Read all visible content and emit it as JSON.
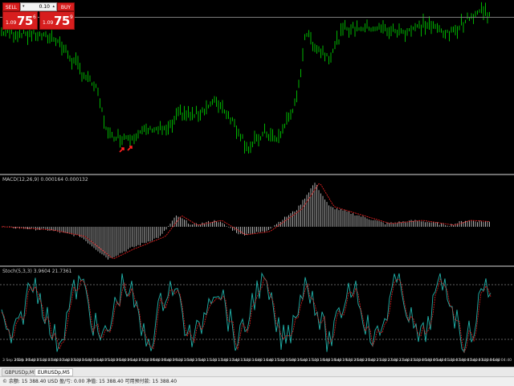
{
  "trade_panel": {
    "sell_label": "SELL",
    "buy_label": "BUY",
    "lot_value": "0.10",
    "sell_quote": {
      "small": "1.09",
      "big": "75",
      "sup": "6"
    },
    "buy_quote": {
      "small": "1.09",
      "big": "75",
      "sup": "9"
    }
  },
  "macd": {
    "label": "MACD(12,26,9) 0.000164 0.000132"
  },
  "stoch": {
    "label": "Stoch(5,3,3) 3.9604 21.7361"
  },
  "time_axis": {
    "labels": [
      "3 Sep 2019",
      "3 Sep 00:40",
      "3 Sep 01:20",
      "3 Sep 02:00",
      "3 Sep 02:40",
      "3 Sep 03:20",
      "3 Sep 04:00",
      "3 Sep 04:40",
      "3 Sep 05:20",
      "3 Sep 06:00",
      "3 Sep 06:40",
      "3 Sep 07:20",
      "3 Sep 08:00",
      "3 Sep 08:40",
      "3 Sep 09:20",
      "3 Sep 10:00",
      "3 Sep 10:40",
      "3 Sep 11:20",
      "3 Sep 12:00",
      "3 Sep 12:40",
      "3 Sep 13:20",
      "3 Sep 14:00",
      "3 Sep 14:40",
      "3 Sep 15:20",
      "3 Sep 16:00",
      "3 Sep 16:40",
      "3 Sep 17:20",
      "3 Sep 18:00",
      "3 Sep 18:40",
      "3 Sep 19:20",
      "3 Sep 20:00",
      "3 Sep 20:40",
      "3 Sep 21:20",
      "3 Sep 22:00",
      "3 Sep 22:40",
      "3 Sep 23:20",
      "4 Sep 00:00",
      "4 Sep 00:40",
      "4 Sep 01:20",
      "4 Sep 02:00",
      "4 Sep 02:40",
      "4 Sep 03:20",
      "4 Sep 04:00",
      "4 Sep 04:40"
    ]
  },
  "tabs": [
    {
      "label": "GBPUSDp,M5",
      "active": false
    },
    {
      "label": "EURUSDp,M5",
      "active": true
    }
  ],
  "status_bar": {
    "text": "© 余额: 15 388.40 USD  盈/亏: 0.00  净值: 15 388.40  可用预付款: 15 388.40"
  },
  "colors": {
    "candle": "#00b400",
    "macd_hist": "#c0c0c0",
    "macd_signal": "#e02020",
    "stoch_main": "#20b2aa",
    "stoch_signal": "#e02020",
    "level_line": "#c0c0c0",
    "arrow": "#ff2020"
  }
}
